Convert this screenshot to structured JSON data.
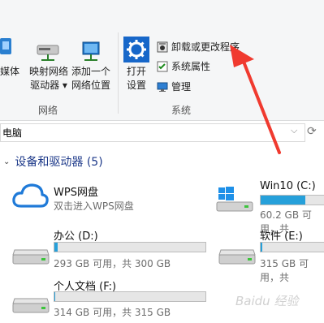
{
  "ribbon": {
    "media_partial": "媒体",
    "map_drive": {
      "line1": "映射网络",
      "line2": "驱动器 ▾"
    },
    "add_location": {
      "line1": "添加一个",
      "line2": "网络位置"
    },
    "network_group": "网络",
    "open_settings": {
      "line1": "打开",
      "line2": "设置"
    },
    "uninstall": "卸载或更改程序",
    "sys_props": "系统属性",
    "manage": "管理",
    "system_group": "系统"
  },
  "address": {
    "text": "电脑",
    "chevron": "⌵",
    "refresh": "⟳"
  },
  "section": {
    "title": "设备和驱动器 (5)",
    "chevron": "⌄"
  },
  "drives": [
    {
      "name": "WPS网盘",
      "subtitle": "双击进入WPS网盘",
      "icon": "cloud-icon"
    },
    {
      "name": "Win10 (C:)",
      "subtitle": "60.2 GB 可用，共",
      "usage": 0.7,
      "icon": "windows-drive-icon"
    },
    {
      "name": "办公 (D:)",
      "subtitle": "293 GB 可用，共 300 GB",
      "usage": 0.02,
      "icon": "hard-drive-icon"
    },
    {
      "name": "软件 (E:)",
      "subtitle": "315 GB 可用，共",
      "usage": 0.02,
      "icon": "hard-drive-icon"
    },
    {
      "name": "个人文档 (F:)",
      "subtitle": "314 GB 可用，共 315 GB",
      "usage": 0.003,
      "icon": "hard-drive-icon"
    }
  ],
  "colors": {
    "accent": "#26a0da",
    "arrow": "#f03a2f",
    "section": "#1e3a8a"
  }
}
